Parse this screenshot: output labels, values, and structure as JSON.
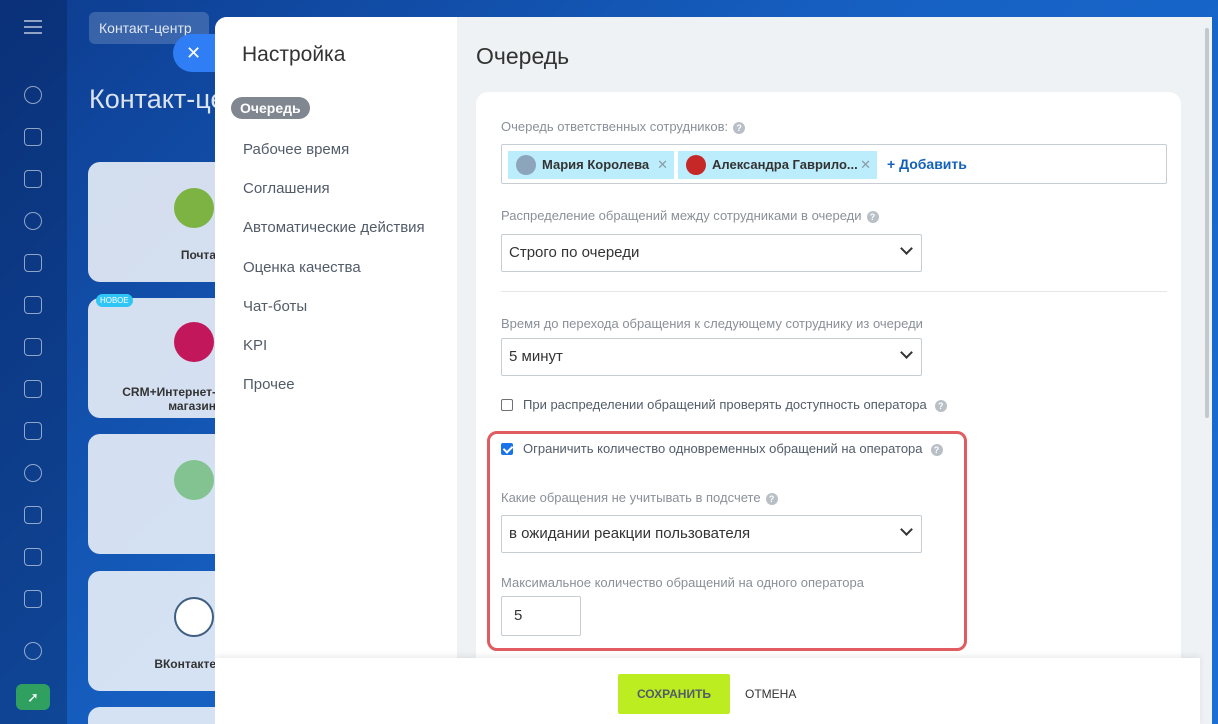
{
  "background": {
    "breadcrumb": "Контакт-центр",
    "title": "Контакт-центр",
    "cards": [
      {
        "label": "Почта"
      },
      {
        "label": "CRM+Интернет-магазин",
        "badge": "НОВОЕ"
      },
      {
        "label": ""
      },
      {
        "label": "ВКонтакте"
      }
    ]
  },
  "sidebar": {
    "title": "Настройка",
    "items": [
      {
        "label": "Очередь",
        "active": true
      },
      {
        "label": "Рабочее время"
      },
      {
        "label": "Соглашения"
      },
      {
        "label": "Автоматические действия"
      },
      {
        "label": "Оценка качества"
      },
      {
        "label": "Чат-боты"
      },
      {
        "label": "KPI"
      },
      {
        "label": "Прочее"
      }
    ]
  },
  "main": {
    "title": "Очередь",
    "queue_label": "Очередь ответственных сотрудников:",
    "employees": [
      {
        "name": "Мария Королева",
        "icon": "user-avatar-icon"
      },
      {
        "name": "Александра Гаврило...",
        "icon": "user-avatar-icon"
      }
    ],
    "add_label": "+ Добавить",
    "distribution_label": "Распределение обращений между сотрудниками в очереди",
    "distribution_value": "Строго по очереди",
    "time_label": "Время до перехода обращения к следующему сотруднику из очереди",
    "time_value": "5 минут",
    "check_availability_label": "При распределении обращений проверять доступность оператора",
    "check_availability_checked": false,
    "limit_label": "Ограничить количество одновременных обращений на оператора",
    "limit_checked": true,
    "exclude_label": "Какие обращения не учитывать в подсчете",
    "exclude_value": "в ожидании реакции пользователя",
    "max_label": "Максимальное количество обращений на одного оператора",
    "max_value": "5"
  },
  "footer": {
    "save_label": "СОХРАНИТЬ",
    "cancel_label": "ОТМЕНА"
  },
  "colors": {
    "save_button": "#bbed21",
    "highlight": "#e05c61",
    "tag_bg": "#bcedfc",
    "close_button": "#2f7ef5"
  }
}
